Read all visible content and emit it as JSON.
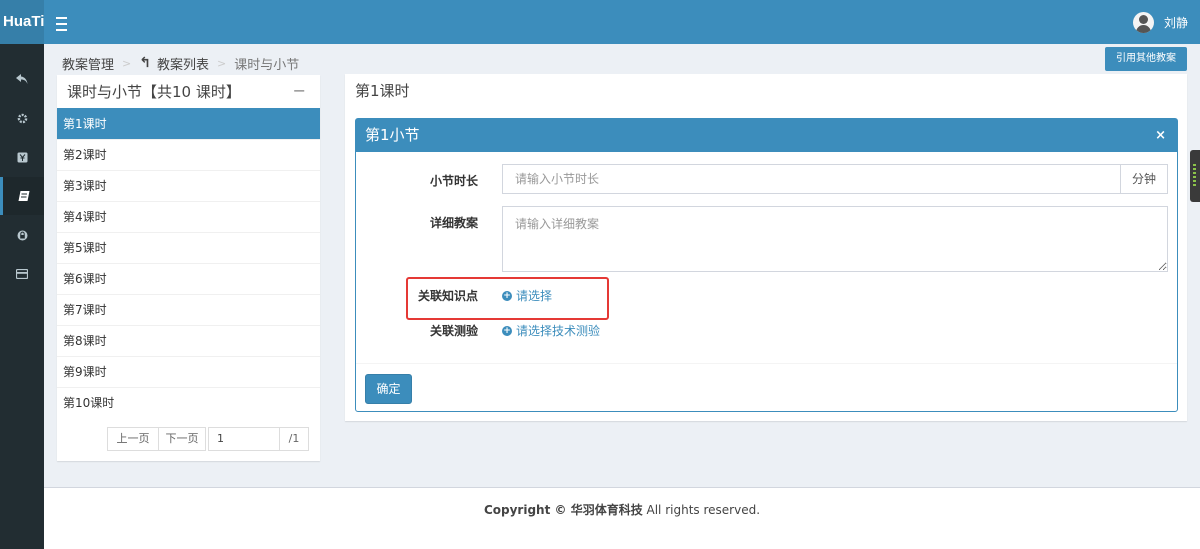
{
  "header": {
    "logo": "HuaTi",
    "user_name": "刘静"
  },
  "sidebar": {
    "items": [
      {
        "icon": "reply-icon"
      },
      {
        "icon": "gear-icon"
      },
      {
        "icon": "yen-icon"
      },
      {
        "icon": "book-icon",
        "active": true
      },
      {
        "icon": "lock-icon"
      },
      {
        "icon": "credit-card-icon"
      }
    ]
  },
  "breadcrumb": {
    "root": "教案管理",
    "parent": "教案列表",
    "current": "课时与小节"
  },
  "toolbar": {
    "reference_button": "引用其他教案"
  },
  "lesson_panel": {
    "title": "课时与小节【共10 课时】",
    "collapse": "−",
    "lessons": [
      "第1课时",
      "第2课时",
      "第3课时",
      "第4课时",
      "第5课时",
      "第6课时",
      "第7课时",
      "第8课时",
      "第9课时",
      "第10课时"
    ],
    "pager": {
      "prev": "上一页",
      "next": "下一页",
      "page_value": "1",
      "total": "/1"
    }
  },
  "detail": {
    "lesson_title": "第1课时",
    "section_title": "第1小节",
    "close": "×",
    "duration_label": "小节时长",
    "duration_placeholder": "请输入小节时长",
    "duration_unit": "分钟",
    "plan_label": "详细教案",
    "plan_placeholder": "请输入详细教案",
    "knowledge_label": "关联知识点",
    "knowledge_link": "请选择",
    "quiz_label": "关联测验",
    "quiz_link": "请选择技术测验",
    "confirm_button": "确定"
  },
  "footer": {
    "copyright": "Copyright © 华羽体育科技",
    "rights": " All rights reserved."
  },
  "colors": {
    "primary": "#3c8dbc",
    "sidebar": "#222d32",
    "highlight": "#e53935"
  }
}
